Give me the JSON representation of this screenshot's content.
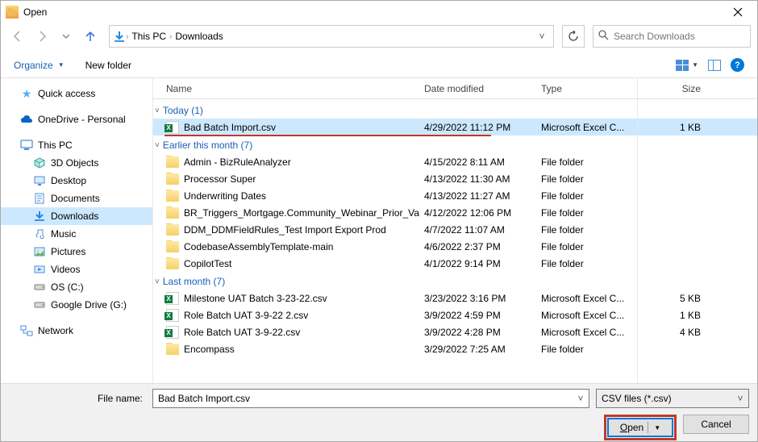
{
  "window": {
    "title": "Open"
  },
  "nav": {
    "breadcrumb": [
      "This PC",
      "Downloads"
    ],
    "search_placeholder": "Search Downloads"
  },
  "toolbar": {
    "organize": "Organize",
    "new_folder": "New folder"
  },
  "columns": {
    "name": "Name",
    "date": "Date modified",
    "type": "Type",
    "size": "Size"
  },
  "sidebar": {
    "quick_access": "Quick access",
    "onedrive": "OneDrive - Personal",
    "this_pc": "This PC",
    "pc_children": [
      "3D Objects",
      "Desktop",
      "Documents",
      "Downloads",
      "Music",
      "Pictures",
      "Videos",
      "OS (C:)",
      "Google Drive (G:)"
    ],
    "network": "Network"
  },
  "groups": [
    {
      "label": "Today (1)",
      "items": [
        {
          "icon": "excel",
          "name": "Bad Batch Import.csv",
          "date": "4/29/2022 11:12 PM",
          "type": "Microsoft Excel C...",
          "size": "1 KB",
          "selected": true
        }
      ]
    },
    {
      "label": "Earlier this month (7)",
      "items": [
        {
          "icon": "folder",
          "name": "Admin - BizRuleAnalyzer",
          "date": "4/15/2022 8:11 AM",
          "type": "File folder",
          "size": ""
        },
        {
          "icon": "folder",
          "name": "Processor Super",
          "date": "4/13/2022 11:30 AM",
          "type": "File folder",
          "size": ""
        },
        {
          "icon": "folder",
          "name": "Underwriting Dates",
          "date": "4/13/2022 11:27 AM",
          "type": "File folder",
          "size": ""
        },
        {
          "icon": "folder",
          "name": "BR_Triggers_Mortgage.Community_Webinar_Prior_Value",
          "date": "4/12/2022 12:06 PM",
          "type": "File folder",
          "size": ""
        },
        {
          "icon": "folder",
          "name": "DDM_DDMFieldRules_Test Import Export Prod",
          "date": "4/7/2022 11:07 AM",
          "type": "File folder",
          "size": ""
        },
        {
          "icon": "folder",
          "name": "CodebaseAssemblyTemplate-main",
          "date": "4/6/2022 2:37 PM",
          "type": "File folder",
          "size": ""
        },
        {
          "icon": "folder",
          "name": "CopilotTest",
          "date": "4/1/2022 9:14 PM",
          "type": "File folder",
          "size": ""
        }
      ]
    },
    {
      "label": "Last month (7)",
      "items": [
        {
          "icon": "excel",
          "name": "Milestone UAT Batch 3-23-22.csv",
          "date": "3/23/2022 3:16 PM",
          "type": "Microsoft Excel C...",
          "size": "5 KB"
        },
        {
          "icon": "excel",
          "name": "Role Batch UAT 3-9-22 2.csv",
          "date": "3/9/2022 4:59 PM",
          "type": "Microsoft Excel C...",
          "size": "1 KB"
        },
        {
          "icon": "excel",
          "name": "Role Batch UAT 3-9-22.csv",
          "date": "3/9/2022 4:28 PM",
          "type": "Microsoft Excel C...",
          "size": "4 KB"
        },
        {
          "icon": "folder",
          "name": "Encompass",
          "date": "3/29/2022 7:25 AM",
          "type": "File folder",
          "size": ""
        }
      ]
    }
  ],
  "footer": {
    "filename_label": "File name:",
    "filename_value": "Bad Batch Import.csv",
    "filter": "CSV files (*.csv)",
    "open": "Open",
    "cancel": "Cancel"
  }
}
